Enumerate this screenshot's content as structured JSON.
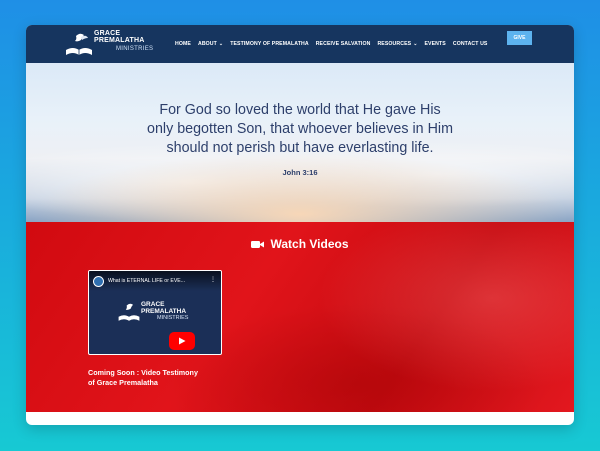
{
  "brand": {
    "line1": "GRACE",
    "line2": "PREMALATHA",
    "sub": "MINISTRIES"
  },
  "nav": {
    "items": [
      {
        "label": "HOME",
        "dropdown": false
      },
      {
        "label": "ABOUT",
        "dropdown": true
      },
      {
        "label": "TESTIMONY OF PREMALATHA",
        "dropdown": false
      },
      {
        "label": "RECEIVE SALVATION",
        "dropdown": false
      },
      {
        "label": "RESOURCES",
        "dropdown": true
      },
      {
        "label": "EVENTS",
        "dropdown": false
      },
      {
        "label": "CONTACT US",
        "dropdown": false
      }
    ],
    "give_label": "GIVE"
  },
  "hero": {
    "verse_lines": [
      "For God so loved the world that He gave His",
      "only begotten Son, that whoever believes in Him",
      "should not perish but have everlasting life."
    ],
    "reference": "John 3:16"
  },
  "videos": {
    "heading": "Watch Videos",
    "heading_icon": "video-camera-icon",
    "thumbnail": {
      "title": "What is ETERNAL LIFE or EVE...",
      "logo_line1": "GRACE",
      "logo_line2": "PREMALATHA",
      "logo_sub": "MINISTRIES"
    },
    "caption_lines": [
      "Coming Soon : Video Testimony",
      "of Grace Premalatha"
    ]
  },
  "colors": {
    "nav_bg": "#16355f",
    "accent_give": "#5db3ef",
    "section_red": "#d10a10",
    "text_navy": "#2d3f6b"
  }
}
